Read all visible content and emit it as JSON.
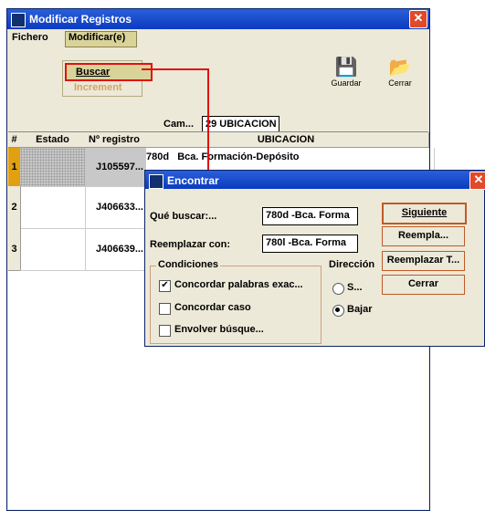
{
  "window": {
    "title": "Modificar Registros",
    "close": "✕"
  },
  "menubar": {
    "fichero": "Fichero",
    "modificar": "Modificar(e)"
  },
  "dropdown": {
    "buscar": "Buscar",
    "increment": "Increment"
  },
  "toolbar": {
    "guardar": "Guardar",
    "cerrar": "Cerrar"
  },
  "campo": {
    "label": "Cam...",
    "value": "29 UBICACION"
  },
  "table": {
    "headers": [
      "#",
      "Estado",
      "Nº registro",
      "UBICACION"
    ],
    "rows": [
      {
        "num": "1",
        "estado": "",
        "registro": "J105597...",
        "ubicacion": "780d   Bca. Formación-Depósito"
      },
      {
        "num": "2",
        "estado": "",
        "registro": "J406633...",
        "ubicacion": ""
      },
      {
        "num": "3",
        "estado": "",
        "registro": "J406639...",
        "ubicacion": ""
      }
    ]
  },
  "dialog": {
    "title": "Encontrar",
    "close": "✕",
    "que_buscar_label": "Qué buscar:...",
    "que_buscar_value": "780d -Bca. Forma",
    "reemplazar_label": "Reemplazar con:",
    "reemplazar_value": "780l -Bca. Forma",
    "buttons": {
      "siguiente": "Siguiente",
      "reemplazar": "Reempla...",
      "reemplazar_todo": "Reemplazar T...",
      "cerrar": "Cerrar"
    },
    "condiciones": {
      "title": "Condiciones",
      "palabras": "Concordar palabras exac...",
      "caso": "Concordar caso",
      "envolver": "Envolver búsque...",
      "palabras_checked": true,
      "caso_checked": false,
      "envolver_checked": false
    },
    "direccion": {
      "title": "Dirección",
      "subir": "S...",
      "bajar": "Bajar",
      "selected": "bajar"
    }
  }
}
